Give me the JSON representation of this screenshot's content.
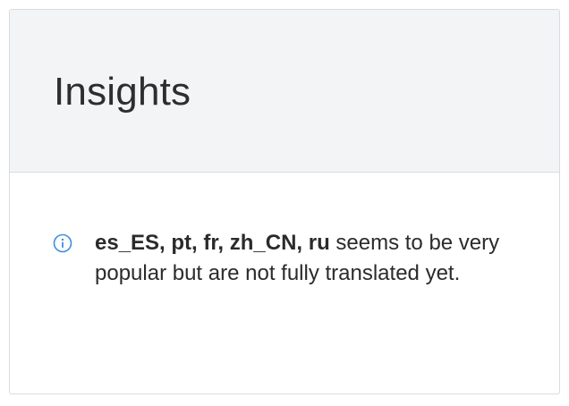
{
  "card": {
    "title": "Insights"
  },
  "insight": {
    "icon": "info-icon",
    "icon_color": "#3b8fe0",
    "languages": "es_ES, pt, fr, zh_CN, ru",
    "message": " seems to be very popular but are not fully translated yet."
  }
}
